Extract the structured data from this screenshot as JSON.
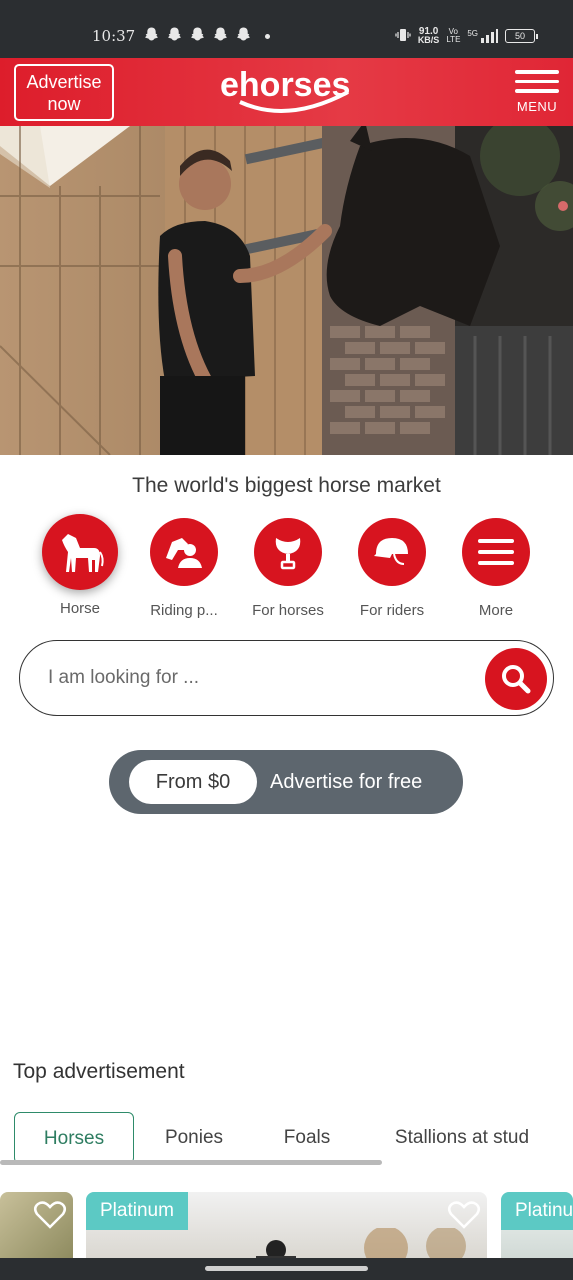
{
  "status_bar": {
    "time": "10:37",
    "net_speed": "91.0",
    "net_unit": "KB/S",
    "network_label": "Vo LTE",
    "signal_label": "5G",
    "battery": "50"
  },
  "header": {
    "advertise_label": "Advertise now",
    "logo_text": "ehorses",
    "menu_label": "MENU"
  },
  "hero": {
    "description_icon": "photo-man-with-horse"
  },
  "tagline": "The world's biggest horse market",
  "categories": [
    {
      "label": "Horse",
      "icon": "horse-icon"
    },
    {
      "label": "Riding p...",
      "icon": "riding-partner-icon"
    },
    {
      "label": "For horses",
      "icon": "saddle-icon"
    },
    {
      "label": "For riders",
      "icon": "helmet-icon"
    },
    {
      "label": "More",
      "icon": "hamburger-icon"
    }
  ],
  "search": {
    "placeholder": "I am looking for ..."
  },
  "advertise_pill": {
    "price": "From $0",
    "cta": "Advertise for free"
  },
  "top_ads": {
    "title": "Top advertisement",
    "tabs": [
      "Horses",
      "Ponies",
      "Foals",
      "Stallions at stud"
    ],
    "active_tab": "Horses",
    "cards": [
      {
        "badge": ""
      },
      {
        "badge": "Platinum"
      },
      {
        "badge": "Platinum"
      }
    ]
  },
  "colors": {
    "brand_red": "#d7141f",
    "pill_gray": "#5d666e",
    "badge_teal": "#5cc9c4",
    "active_tab": "#2e8b6a"
  }
}
